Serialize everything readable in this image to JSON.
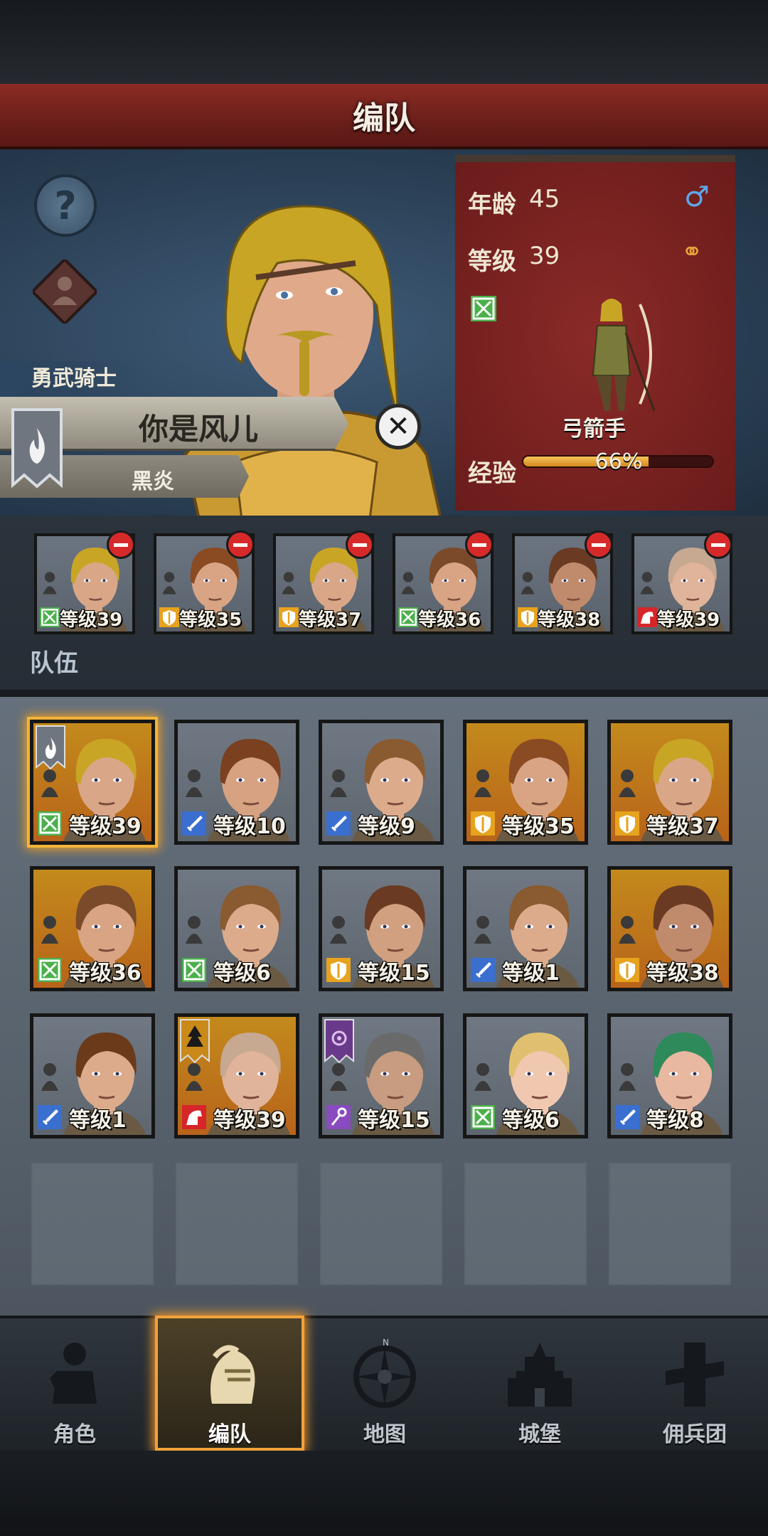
{
  "header": {
    "title": "编队"
  },
  "hero": {
    "title": "勇武骑士",
    "name": "你是风儿",
    "faction": "黑炎",
    "age_label": "年龄",
    "age": "45",
    "level_label": "等级",
    "level": "39",
    "class_name": "弓箭手",
    "exp_label": "经验",
    "exp_text": "66%",
    "exp_fraction": 0.66
  },
  "team": {
    "label": "队伍",
    "members": [
      {
        "level": "等级39",
        "class": "archer",
        "hair": "#c9a526",
        "skin": "#d9a788"
      },
      {
        "level": "等级35",
        "class": "shield",
        "hair": "#8a4a22",
        "skin": "#d8a484"
      },
      {
        "level": "等级37",
        "class": "shield",
        "hair": "#c9a526",
        "skin": "#d9a788"
      },
      {
        "level": "等级36",
        "class": "archer",
        "hair": "#7a4a2a",
        "skin": "#d8a484"
      },
      {
        "level": "等级38",
        "class": "shield",
        "hair": "#6a3a22",
        "skin": "#c08a6c"
      },
      {
        "level": "等级39",
        "class": "cavalry",
        "hair": "#c7a890",
        "skin": "#e0b49a"
      }
    ]
  },
  "roster": [
    {
      "level": "等级39",
      "class": "archer",
      "bg": "gold",
      "hair": "#c9a526",
      "skin": "#d9a788",
      "selected": true,
      "flag": "fire"
    },
    {
      "level": "等级10",
      "class": "sword",
      "bg": "grey",
      "hair": "#7a4020",
      "skin": "#d6a282"
    },
    {
      "level": "等级9",
      "class": "sword",
      "bg": "grey",
      "hair": "#8a5a30",
      "skin": "#dcab8c"
    },
    {
      "level": "等级35",
      "class": "shield",
      "bg": "gold",
      "hair": "#8a4a22",
      "skin": "#d8a484"
    },
    {
      "level": "等级37",
      "class": "shield",
      "bg": "gold",
      "hair": "#c9a526",
      "skin": "#d9a788"
    },
    {
      "level": "等级36",
      "class": "archer",
      "bg": "gold",
      "hair": "#7a4a2a",
      "skin": "#d8a484"
    },
    {
      "level": "等级6",
      "class": "archer",
      "bg": "grey",
      "hair": "#8a5a30",
      "skin": "#dcab8c"
    },
    {
      "level": "等级15",
      "class": "shield",
      "bg": "grey",
      "hair": "#6a3a22",
      "skin": "#d0a080"
    },
    {
      "level": "等级1",
      "class": "sword",
      "bg": "grey",
      "hair": "#8a5a30",
      "skin": "#dcab8c"
    },
    {
      "level": "等级38",
      "class": "shield",
      "bg": "gold",
      "hair": "#6a3a22",
      "skin": "#c08a6c"
    },
    {
      "level": "等级1",
      "class": "sword",
      "bg": "grey",
      "hair": "#6a3a1a",
      "skin": "#dcab8c"
    },
    {
      "level": "等级39",
      "class": "cavalry",
      "bg": "gold",
      "hair": "#c7a890",
      "skin": "#e0b49a",
      "flag": "tree"
    },
    {
      "level": "等级15",
      "class": "mage",
      "bg": "grey",
      "hair": "#6a6a6a",
      "skin": "#c89c80",
      "flag": "eye"
    },
    {
      "level": "等级6",
      "class": "archer",
      "bg": "grey",
      "hair": "#e0c070",
      "skin": "#f0c8b0"
    },
    {
      "level": "等级8",
      "class": "sword",
      "bg": "grey",
      "hair": "#2e8a5a",
      "skin": "#e8b8a0"
    }
  ],
  "nav": [
    {
      "label": "角色",
      "icon": "knight-icon"
    },
    {
      "label": "编队",
      "icon": "helmet-icon",
      "active": true
    },
    {
      "label": "地图",
      "icon": "compass-icon"
    },
    {
      "label": "城堡",
      "icon": "castle-icon"
    },
    {
      "label": "佣兵团",
      "icon": "mercenary-icon"
    }
  ],
  "colors": {
    "title_red": "#7a2520",
    "archer": "#4bb04b",
    "shield": "#e7a21e",
    "sword": "#3a6fd0",
    "cavalry": "#d6262a",
    "mage": "#8a4ac0",
    "accent_gold": "#f2b43a"
  }
}
